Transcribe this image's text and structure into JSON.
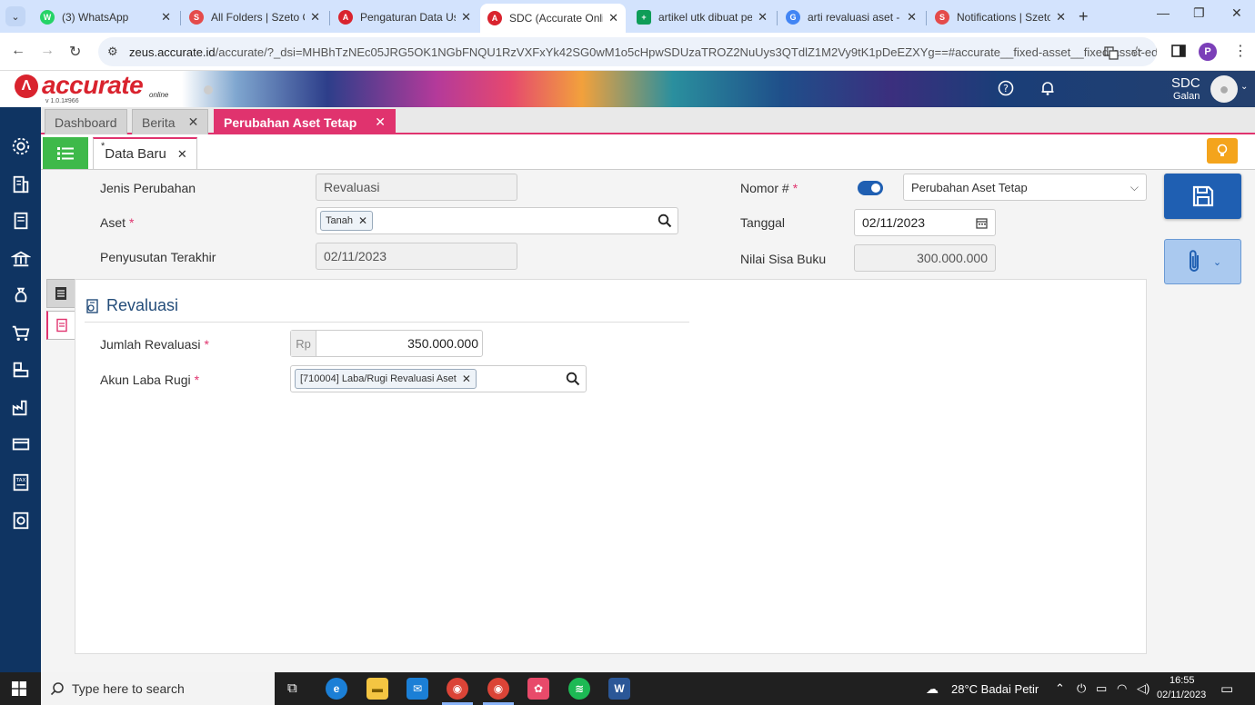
{
  "browser": {
    "tabs": [
      {
        "title": "(3) WhatsApp",
        "color": "#25d366",
        "glyph": "W"
      },
      {
        "title": "All Folders | Szeto C",
        "color": "#e44b4b",
        "glyph": "S"
      },
      {
        "title": "Pengaturan Data Us",
        "color": "#d9232e",
        "glyph": "A"
      },
      {
        "title": "SDC (Accurate Onlin",
        "color": "#d9232e",
        "glyph": "A"
      },
      {
        "title": "artikel utk dibuat pe",
        "color": "#0f9d58",
        "glyph": "+"
      },
      {
        "title": "arti revaluasi aset - (",
        "color": "#4285f4",
        "glyph": "G"
      },
      {
        "title": "Notifications | Szeto",
        "color": "#e44b4b",
        "glyph": "S"
      }
    ],
    "url_host": "zeus.accurate.id",
    "url_path": "/accurate/?_dsi=MHBhTzNEc05JRG5OK1NGbFNQU1RzVXFxYk42SG0wM1o5cHpwSDUzaTROZ2NuUys3QTdlZ1M2Vy9tK1pDeEZXYg==#accurate__fixed-asset__fixed-asset-edited",
    "profile_initial": "P"
  },
  "app": {
    "logo_text": "accurate",
    "logo_sub": "online",
    "version": "v 1.0.1#966",
    "user_name": "SDC",
    "user_sub": "Galan"
  },
  "module_tabs": [
    {
      "label": "Dashboard"
    },
    {
      "label": "Berita"
    },
    {
      "label": "Perubahan Aset Tetap"
    }
  ],
  "module_count": "3",
  "subtab": {
    "marker": "*",
    "label": "Data Baru"
  },
  "form": {
    "jenis_label": "Jenis Perubahan",
    "jenis_value": "Revaluasi",
    "aset_label": "Aset",
    "aset_chip": "Tanah",
    "penyusutan_label": "Penyusutan Terakhir",
    "penyusutan_value": "02/11/2023",
    "nomor_label": "Nomor #",
    "nomor_select": "Perubahan Aset Tetap",
    "tanggal_label": "Tanggal",
    "tanggal_value": "02/11/2023",
    "nilai_label": "Nilai Sisa Buku",
    "nilai_value": "300.000.000"
  },
  "panel": {
    "title": "Revaluasi",
    "jumlah_label": "Jumlah Revaluasi",
    "currency_prefix": "Rp",
    "jumlah_value": "350.000.000",
    "akun_label": "Akun Laba Rugi",
    "akun_chip": "[710004] Laba/Rugi Revaluasi Aset"
  },
  "taskbar": {
    "search_placeholder": "Type here to search",
    "weather": "28°C  Badai Petir",
    "time": "16:55",
    "date": "02/11/2023"
  }
}
